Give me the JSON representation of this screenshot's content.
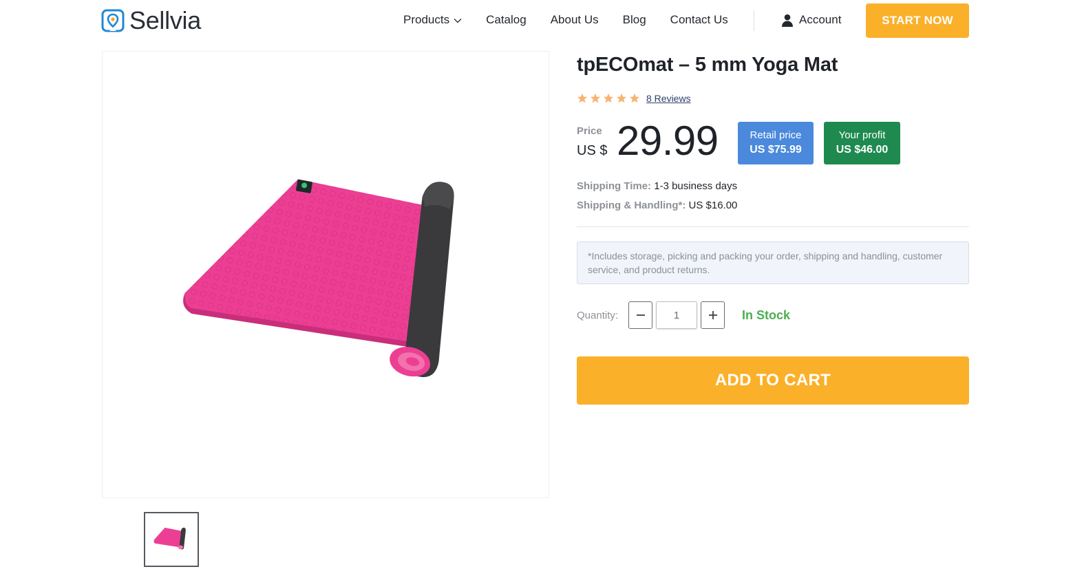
{
  "header": {
    "logo_text": "Sellvia",
    "nav": [
      {
        "label": "Products",
        "has_dropdown": true
      },
      {
        "label": "Catalog"
      },
      {
        "label": "About Us"
      },
      {
        "label": "Blog"
      },
      {
        "label": "Contact Us"
      }
    ],
    "account_label": "Account",
    "cta_label": "START NOW"
  },
  "product": {
    "title": "tpECOmat – 5 mm Yoga Mat",
    "rating": 5,
    "reviews_label": "8 Reviews",
    "price_label": "Price",
    "price_currency": "US $",
    "price_value": "29.99",
    "retail": {
      "label": "Retail price",
      "value": "US $75.99"
    },
    "profit": {
      "label": "Your profit",
      "value": "US $46.00"
    },
    "shipping_time": {
      "label": "Shipping Time:",
      "value": "1-3 business days"
    },
    "shipping_handling": {
      "label": "Shipping & Handling*:",
      "value": "US $16.00"
    },
    "note": "*Includes storage, picking and packing your order, shipping and handling, customer service, and product returns.",
    "quantity_label": "Quantity:",
    "quantity_value": "1",
    "stock_status": "In Stock",
    "add_to_cart_label": "ADD TO CART"
  },
  "colors": {
    "accent": "#fbb02a",
    "retail_badge": "#4a89dc",
    "profit_badge": "#1e8a4f",
    "in_stock": "#4cae4f",
    "mat_pink": "#ec3f94",
    "mat_dark": "#3a3a3c"
  },
  "icons": {
    "logo": "location-pin-logo-icon",
    "dropdown": "chevron-down-icon",
    "account": "user-icon",
    "star": "star-icon",
    "minus": "minus-icon",
    "plus": "plus-icon"
  }
}
